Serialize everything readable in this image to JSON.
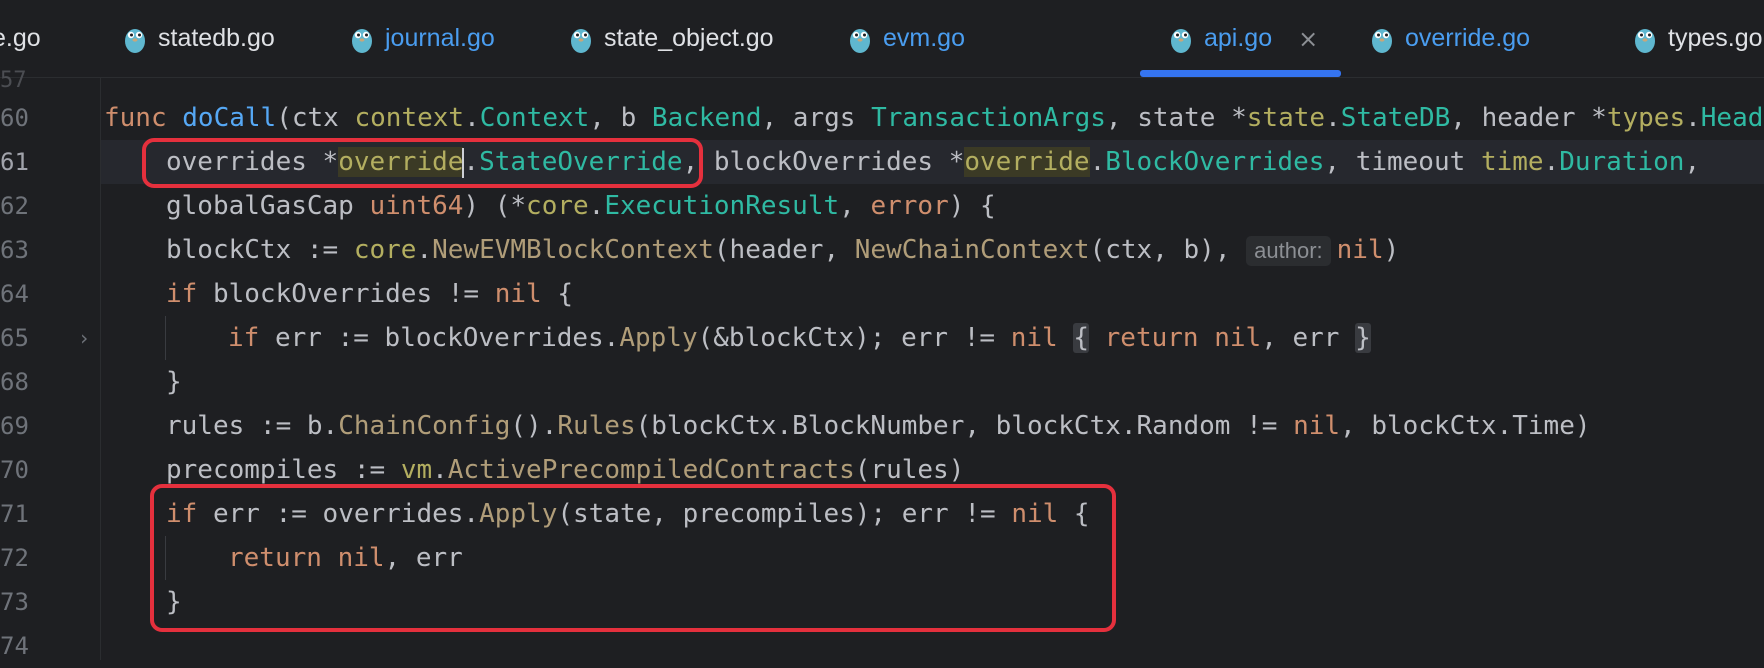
{
  "tabs": [
    {
      "label": "e.go",
      "color": "default"
    },
    {
      "label": "statedb.go",
      "color": "default"
    },
    {
      "label": "journal.go",
      "color": "blue"
    },
    {
      "label": "state_object.go",
      "color": "default"
    },
    {
      "label": "evm.go",
      "color": "blue"
    },
    {
      "label": "api.go",
      "color": "blue",
      "active": true
    },
    {
      "label": "override.go",
      "color": "blue"
    },
    {
      "label": "types.go",
      "color": "default"
    }
  ],
  "close_glyph": "×",
  "gutter": {
    "top_partial": "57",
    "lines": [
      "60",
      "61",
      "62",
      "63",
      "64",
      "65",
      "68",
      "69",
      "70",
      "71",
      "72",
      "73",
      "74"
    ]
  },
  "code": {
    "l60": {
      "func": "func",
      "name": "doCall",
      "p1": "(ctx ",
      "pkg1": "context",
      "dot1": ".",
      "t1": "Context",
      "p2": ", b ",
      "t2": "Backend",
      "p3": ", args ",
      "t3": "TransactionArgs",
      "p4": ", state *",
      "pkg2": "state",
      "dot2": ".",
      "t4": "StateDB",
      "p5": ", header *",
      "pkg3": "types",
      "dot3": ".",
      "t5": "Header"
    },
    "l61": {
      "a": "overrides *",
      "pkg1": "override",
      "dot1": ".",
      "t1": "StateOverride",
      "comma": ",",
      "b": " blockOverrides *",
      "pkg2": "override",
      "dot2": ".",
      "t2": "BlockOverrides",
      "c": ", timeout ",
      "pkg3": "time",
      "dot3": ".",
      "t3": "Duration",
      "d": ","
    },
    "l62": {
      "a": "globalGasCap ",
      "t1": "uint64",
      "b": ") (*",
      "pkg1": "core",
      "dot1": ".",
      "t2": "ExecutionResult",
      "c": ", ",
      "t3": "error",
      "d": ") {"
    },
    "l63": {
      "a": "blockCtx := ",
      "pkg1": "core",
      "dot1": ".",
      "m1": "NewEVMBlockContext",
      "b": "(header, ",
      "m2": "NewChainContext",
      "c": "(ctx, b), ",
      "hint": "author:",
      "nil": "nil",
      "d": ")"
    },
    "l64": {
      "kw": "if",
      "a": " blockOverrides != ",
      "nil": "nil",
      "b": " {"
    },
    "l65": {
      "kw": "if",
      "a": " err := blockOverrides.",
      "m1": "Apply",
      "b": "(&blockCtx); err != ",
      "nil1": "nil",
      "sp": " ",
      "ob": "{",
      "ret": " return",
      "sp2": " ",
      "nil2": "nil",
      "c": ", err ",
      "cb": "}"
    },
    "l68": {
      "a": "}"
    },
    "l69": {
      "a": "rules := b.",
      "m1": "ChainConfig",
      "b": "().",
      "m2": "Rules",
      "c": "(blockCtx.BlockNumber, blockCtx.Random != ",
      "nil": "nil",
      "d": ", blockCtx.Time)"
    },
    "l70": {
      "a": "precompiles := ",
      "pkg1": "vm",
      "dot1": ".",
      "m1": "ActivePrecompiledContracts",
      "b": "(rules)"
    },
    "l71": {
      "kw": "if",
      "a": " err := overrides.",
      "m1": "Apply",
      "b": "(state, precompiles); err != ",
      "nil": "nil",
      "c": " {"
    },
    "l72": {
      "kw": "return",
      "sp": " ",
      "nil": "nil",
      "a": ", err"
    },
    "l73": {
      "a": "}"
    }
  },
  "colors": {
    "accent": "#3574f0",
    "highlight_box": "#e5303d",
    "background": "#1e1f22"
  }
}
